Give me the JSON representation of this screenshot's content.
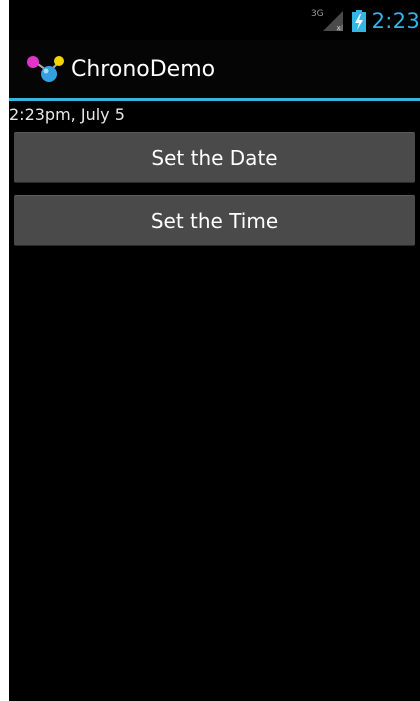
{
  "status_bar": {
    "network_type": "3G",
    "time": "2:23",
    "icons": [
      "signal-icon",
      "battery-charging-icon"
    ]
  },
  "action_bar": {
    "title": "ChronoDemo",
    "icon": "chrono-app-icon"
  },
  "content": {
    "date_time_text": "2:23pm, July 5",
    "buttons": [
      {
        "label": "Set the Date"
      },
      {
        "label": "Set the Time"
      }
    ]
  },
  "colors": {
    "accent": "#33b5e5",
    "button_bg": "#4a4a4a",
    "background": "#000000"
  }
}
